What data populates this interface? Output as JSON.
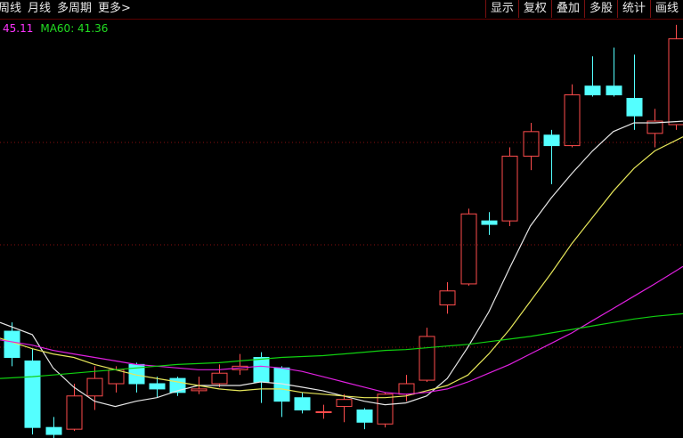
{
  "menu": {
    "items": [
      "周线",
      "月线",
      "多周期",
      "更多>"
    ],
    "buttons": [
      "显示",
      "复权",
      "叠加",
      "多股",
      "统计",
      "画线"
    ]
  },
  "legend": {
    "ma_a": "45.11",
    "ma60": "MA60: 41.36"
  },
  "colors": {
    "up": "#ff4d4d",
    "down": "#54ffff",
    "ma_white": "#e6e6e6",
    "ma_yellow": "#e6e65a",
    "ma_magenta": "#e020e0",
    "ma_green": "#10d010",
    "grid": "#8a1010"
  },
  "chart_data": {
    "type": "candlestick",
    "y_min": 34.5,
    "y_max": 58.3,
    "candles": [
      {
        "o": 40.5,
        "h": 41.0,
        "l": 38.5,
        "c": 39.0
      },
      {
        "o": 38.8,
        "h": 39.5,
        "l": 34.6,
        "c": 35.0
      },
      {
        "o": 35.0,
        "h": 35.6,
        "l": 34.3,
        "c": 34.6
      },
      {
        "o": 34.9,
        "h": 37.5,
        "l": 34.8,
        "c": 36.8
      },
      {
        "o": 36.8,
        "h": 38.5,
        "l": 36.0,
        "c": 37.8
      },
      {
        "o": 37.5,
        "h": 38.5,
        "l": 37.0,
        "c": 38.3
      },
      {
        "o": 38.6,
        "h": 38.7,
        "l": 37.0,
        "c": 37.5
      },
      {
        "o": 37.5,
        "h": 37.9,
        "l": 36.7,
        "c": 37.2
      },
      {
        "o": 37.8,
        "h": 37.9,
        "l": 36.8,
        "c": 37.0
      },
      {
        "o": 37.1,
        "h": 37.9,
        "l": 36.9,
        "c": 37.2
      },
      {
        "o": 37.5,
        "h": 38.6,
        "l": 37.3,
        "c": 38.1
      },
      {
        "o": 38.3,
        "h": 39.2,
        "l": 38.0,
        "c": 38.5
      },
      {
        "o": 39.0,
        "h": 39.3,
        "l": 36.4,
        "c": 37.6
      },
      {
        "o": 38.4,
        "h": 38.5,
        "l": 35.6,
        "c": 36.5
      },
      {
        "o": 36.7,
        "h": 37.0,
        "l": 35.8,
        "c": 36.0
      },
      {
        "o": 35.9,
        "h": 36.3,
        "l": 35.5,
        "c": 35.9
      },
      {
        "o": 36.2,
        "h": 36.9,
        "l": 35.3,
        "c": 36.6
      },
      {
        "o": 36.0,
        "h": 36.1,
        "l": 34.9,
        "c": 35.3
      },
      {
        "o": 35.2,
        "h": 37.0,
        "l": 35.0,
        "c": 36.9
      },
      {
        "o": 36.9,
        "h": 38.0,
        "l": 36.5,
        "c": 37.5
      },
      {
        "o": 37.7,
        "h": 40.7,
        "l": 37.6,
        "c": 40.2
      },
      {
        "o": 42.0,
        "h": 43.3,
        "l": 41.5,
        "c": 42.8
      },
      {
        "o": 43.2,
        "h": 47.5,
        "l": 43.1,
        "c": 47.2
      },
      {
        "o": 46.8,
        "h": 47.3,
        "l": 46.0,
        "c": 46.6
      },
      {
        "o": 46.8,
        "h": 51.0,
        "l": 46.5,
        "c": 50.5
      },
      {
        "o": 50.5,
        "h": 52.4,
        "l": 49.7,
        "c": 51.9
      },
      {
        "o": 51.7,
        "h": 52.0,
        "l": 48.9,
        "c": 51.1
      },
      {
        "o": 51.1,
        "h": 54.6,
        "l": 51.0,
        "c": 54.0
      },
      {
        "o": 54.5,
        "h": 56.2,
        "l": 53.9,
        "c": 54.0
      },
      {
        "o": 54.5,
        "h": 56.7,
        "l": 53.9,
        "c": 54.0
      },
      {
        "o": 53.8,
        "h": 56.3,
        "l": 52.0,
        "c": 52.8
      },
      {
        "o": 51.8,
        "h": 53.2,
        "l": 51.0,
        "c": 52.5
      },
      {
        "o": 52.3,
        "h": 58.0,
        "l": 52.0,
        "c": 57.2
      }
    ],
    "series": [
      {
        "color": "#e6e6e6",
        "values": [
          41,
          40.3,
          38.4,
          37.3,
          36.5,
          36.2,
          36.5,
          36.7,
          37.1,
          37.4,
          37.4,
          37.4,
          37.6,
          37.5,
          37.3,
          37.1,
          36.8,
          36.5,
          36.3,
          36.4,
          36.8,
          37.8,
          39.6,
          41.6,
          44.1,
          46.5,
          48.1,
          49.5,
          50.8,
          51.9,
          52.4,
          52.4,
          52.5
        ]
      },
      {
        "color": "#e6e65a",
        "values": [
          40.1,
          39.5,
          39.2,
          39.0,
          38.6,
          38.3,
          38.0,
          37.8,
          37.6,
          37.4,
          37.2,
          37.1,
          37.2,
          37.2,
          37.0,
          36.9,
          36.8,
          36.7,
          36.7,
          36.8,
          37.1,
          37.4,
          38.0,
          39.2,
          40.6,
          42.2,
          43.8,
          45.5,
          47.0,
          48.5,
          49.8,
          50.8,
          51.6
        ]
      },
      {
        "color": "#e020e0",
        "values": [
          40.0,
          39.7,
          39.4,
          39.2,
          39.0,
          38.8,
          38.6,
          38.5,
          38.4,
          38.3,
          38.3,
          38.4,
          38.5,
          38.4,
          38.2,
          37.9,
          37.6,
          37.3,
          37.0,
          36.9,
          37.0,
          37.2,
          37.6,
          38.1,
          38.6,
          39.2,
          39.8,
          40.4,
          41.1,
          41.8,
          42.5,
          43.2,
          44.2
        ]
      },
      {
        "color": "#10d010",
        "values": [
          37.8,
          37.9,
          38.0,
          38.1,
          38.2,
          38.3,
          38.4,
          38.5,
          38.6,
          38.65,
          38.7,
          38.8,
          38.9,
          39.0,
          39.05,
          39.1,
          39.2,
          39.3,
          39.4,
          39.45,
          39.55,
          39.65,
          39.75,
          39.9,
          40.05,
          40.2,
          40.4,
          40.6,
          40.8,
          41.0,
          41.2,
          41.35,
          41.5
        ]
      }
    ]
  }
}
